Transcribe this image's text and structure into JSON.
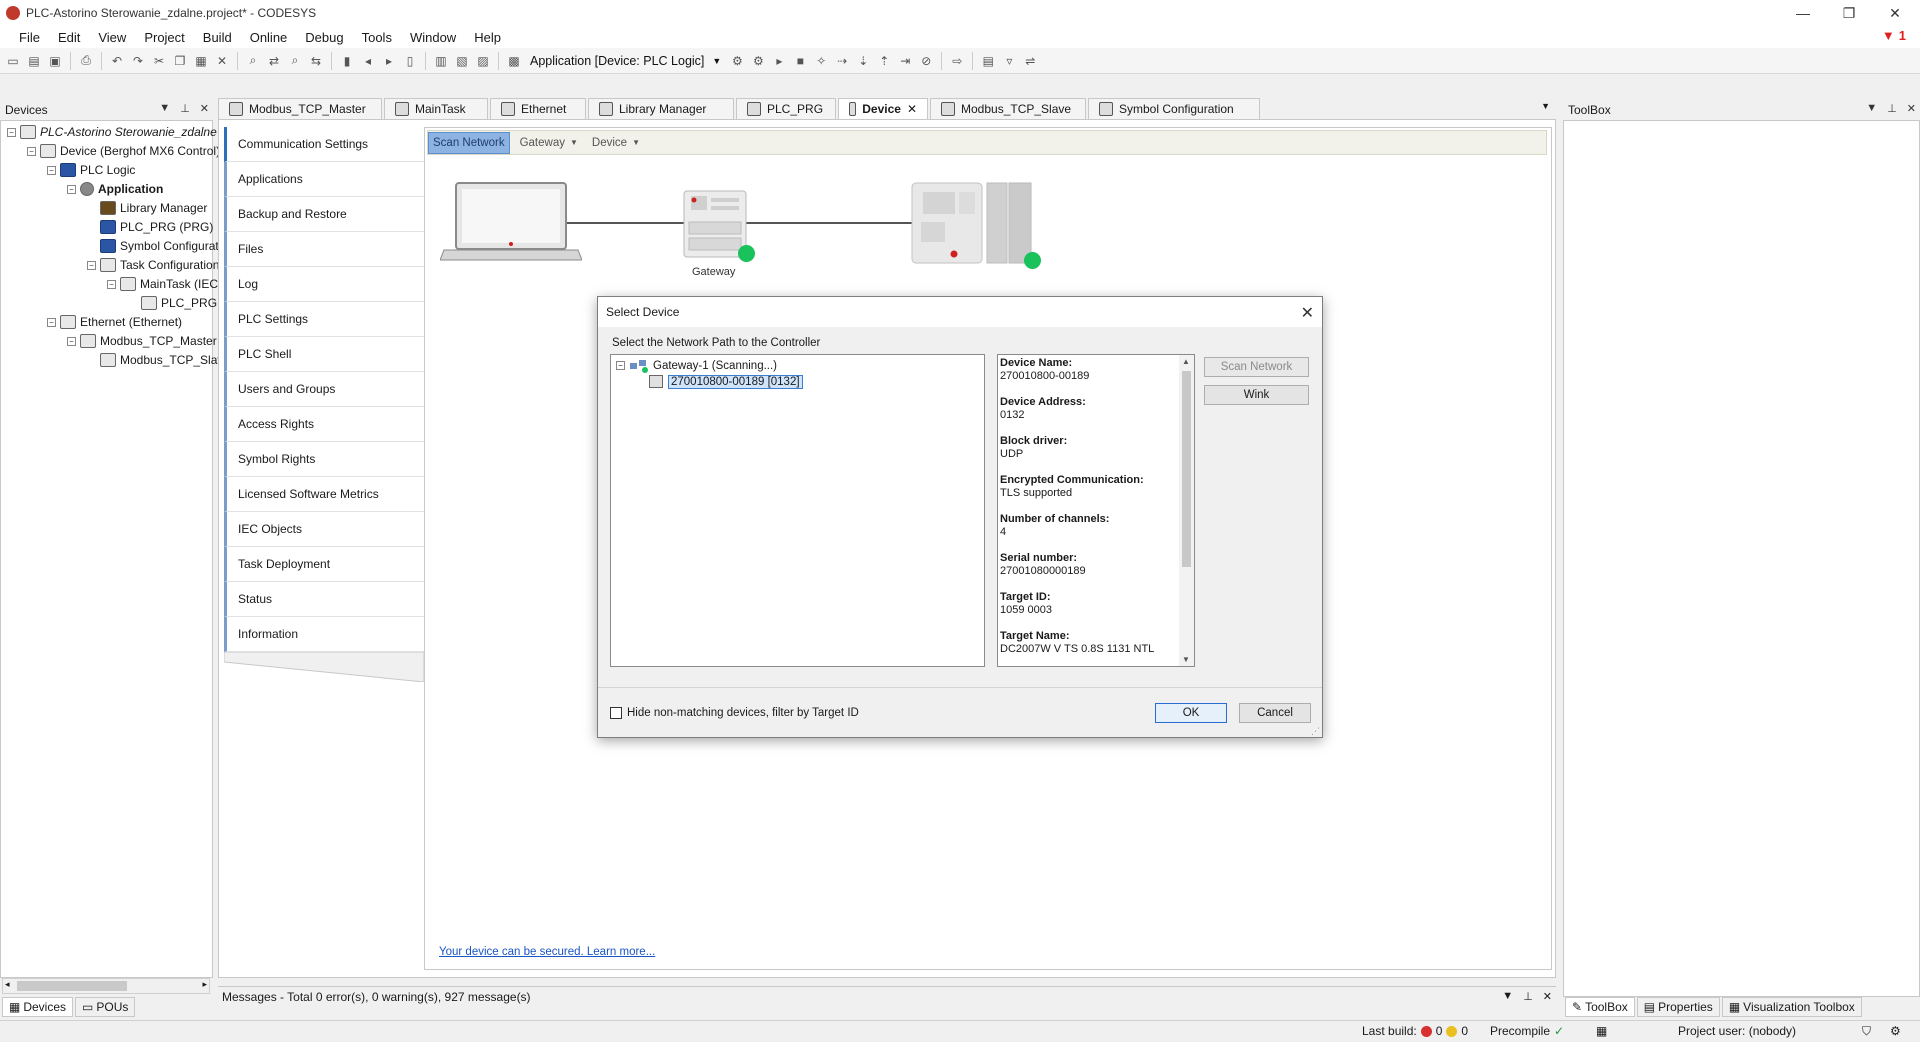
{
  "window": {
    "title": "PLC-Astorino Sterowanie_zdalne.project* - CODESYS",
    "minimize": "—",
    "restore": "❐",
    "close": "✕",
    "alert_count": "1"
  },
  "menu": [
    "File",
    "Edit",
    "View",
    "Project",
    "Build",
    "Online",
    "Debug",
    "Tools",
    "Window",
    "Help"
  ],
  "toolbar": {
    "active_application": "Application [Device: PLC Logic]"
  },
  "devices_panel": {
    "title": "Devices",
    "tree": [
      {
        "label": "PLC-Astorino Sterowanie_zdalne",
        "level": 0,
        "expander": "−",
        "italic": true
      },
      {
        "label": "Device (Berghof MX6 Control)",
        "level": 1,
        "expander": "−"
      },
      {
        "label": "PLC Logic",
        "level": 2,
        "expander": "−"
      },
      {
        "label": "Application",
        "level": 3,
        "expander": "−",
        "bold": true
      },
      {
        "label": "Library Manager",
        "level": 4
      },
      {
        "label": "PLC_PRG (PRG)",
        "level": 4
      },
      {
        "label": "Symbol Configurati",
        "level": 4
      },
      {
        "label": "Task Configuration",
        "level": 4,
        "expander": "−"
      },
      {
        "label": "MainTask (IEC",
        "level": 5,
        "expander": "−"
      },
      {
        "label": "PLC_PRG",
        "level": 6
      },
      {
        "label": "Ethernet (Ethernet)",
        "level": 1,
        "expander": "−"
      },
      {
        "label": "Modbus_TCP_Master (I",
        "level": 2,
        "expander": "−"
      },
      {
        "label": "Modbus_TCP_Slave",
        "level": 3
      }
    ],
    "bottom_tabs": [
      "Devices",
      "POUs"
    ]
  },
  "editor_tabs": [
    {
      "label": "Modbus_TCP_Master"
    },
    {
      "label": "MainTask"
    },
    {
      "label": "Ethernet"
    },
    {
      "label": "Library Manager"
    },
    {
      "label": "PLC_PRG"
    },
    {
      "label": "Device",
      "active": true,
      "close": "✕"
    },
    {
      "label": "Modbus_TCP_Slave"
    },
    {
      "label": "Symbol Configuration"
    }
  ],
  "device_nav": [
    "Communication Settings",
    "Applications",
    "Backup and Restore",
    "Files",
    "Log",
    "PLC Settings",
    "PLC Shell",
    "Users and Groups",
    "Access Rights",
    "Symbol Rights",
    "Licensed Software Metrics",
    "IEC Objects",
    "Task Deployment",
    "Status",
    "Information"
  ],
  "device_toolbar": {
    "scan_network": "Scan Network",
    "gateway": "Gateway",
    "device": "Device"
  },
  "diagram": {
    "gateway_label": "Gateway"
  },
  "secure_link": "Your device can be secured. Learn more...",
  "dialog": {
    "title": "Select Device",
    "path_label": "Select the Network Path to the Controller",
    "gateway_node": "Gateway-1 (Scanning...)",
    "device_node": "270010800-00189 [0132]",
    "info": [
      {
        "label": "Device Name:",
        "value": "270010800-00189"
      },
      {
        "label": "Device Address:",
        "value": "0132"
      },
      {
        "label": "Block driver:",
        "value": "UDP"
      },
      {
        "label": "Encrypted Communication:",
        "value": "TLS supported"
      },
      {
        "label": "Number of channels:",
        "value": "4"
      },
      {
        "label": "Serial number:",
        "value": "27001080000189"
      },
      {
        "label": "Target ID:",
        "value": "1059 0003"
      },
      {
        "label": "Target Name:",
        "value": "DC2007W V TS 0.8S 1131 NTL"
      }
    ],
    "scan_network_btn": "Scan Network",
    "wink_btn": "Wink",
    "filter_checkbox": "Hide non-matching devices, filter by Target ID",
    "ok_btn": "OK",
    "cancel_btn": "Cancel"
  },
  "toolbox_panel": {
    "title": "ToolBox",
    "bottom_tabs": [
      "ToolBox",
      "Properties",
      "Visualization Toolbox"
    ]
  },
  "messages": {
    "summary": "Messages - Total 0 error(s), 0 warning(s), 927 message(s)"
  },
  "statusbar": {
    "last_build": "Last build:",
    "errors": "0",
    "warnings": "0",
    "precompile": "Precompile",
    "project_user": "Project user: (nobody)"
  }
}
